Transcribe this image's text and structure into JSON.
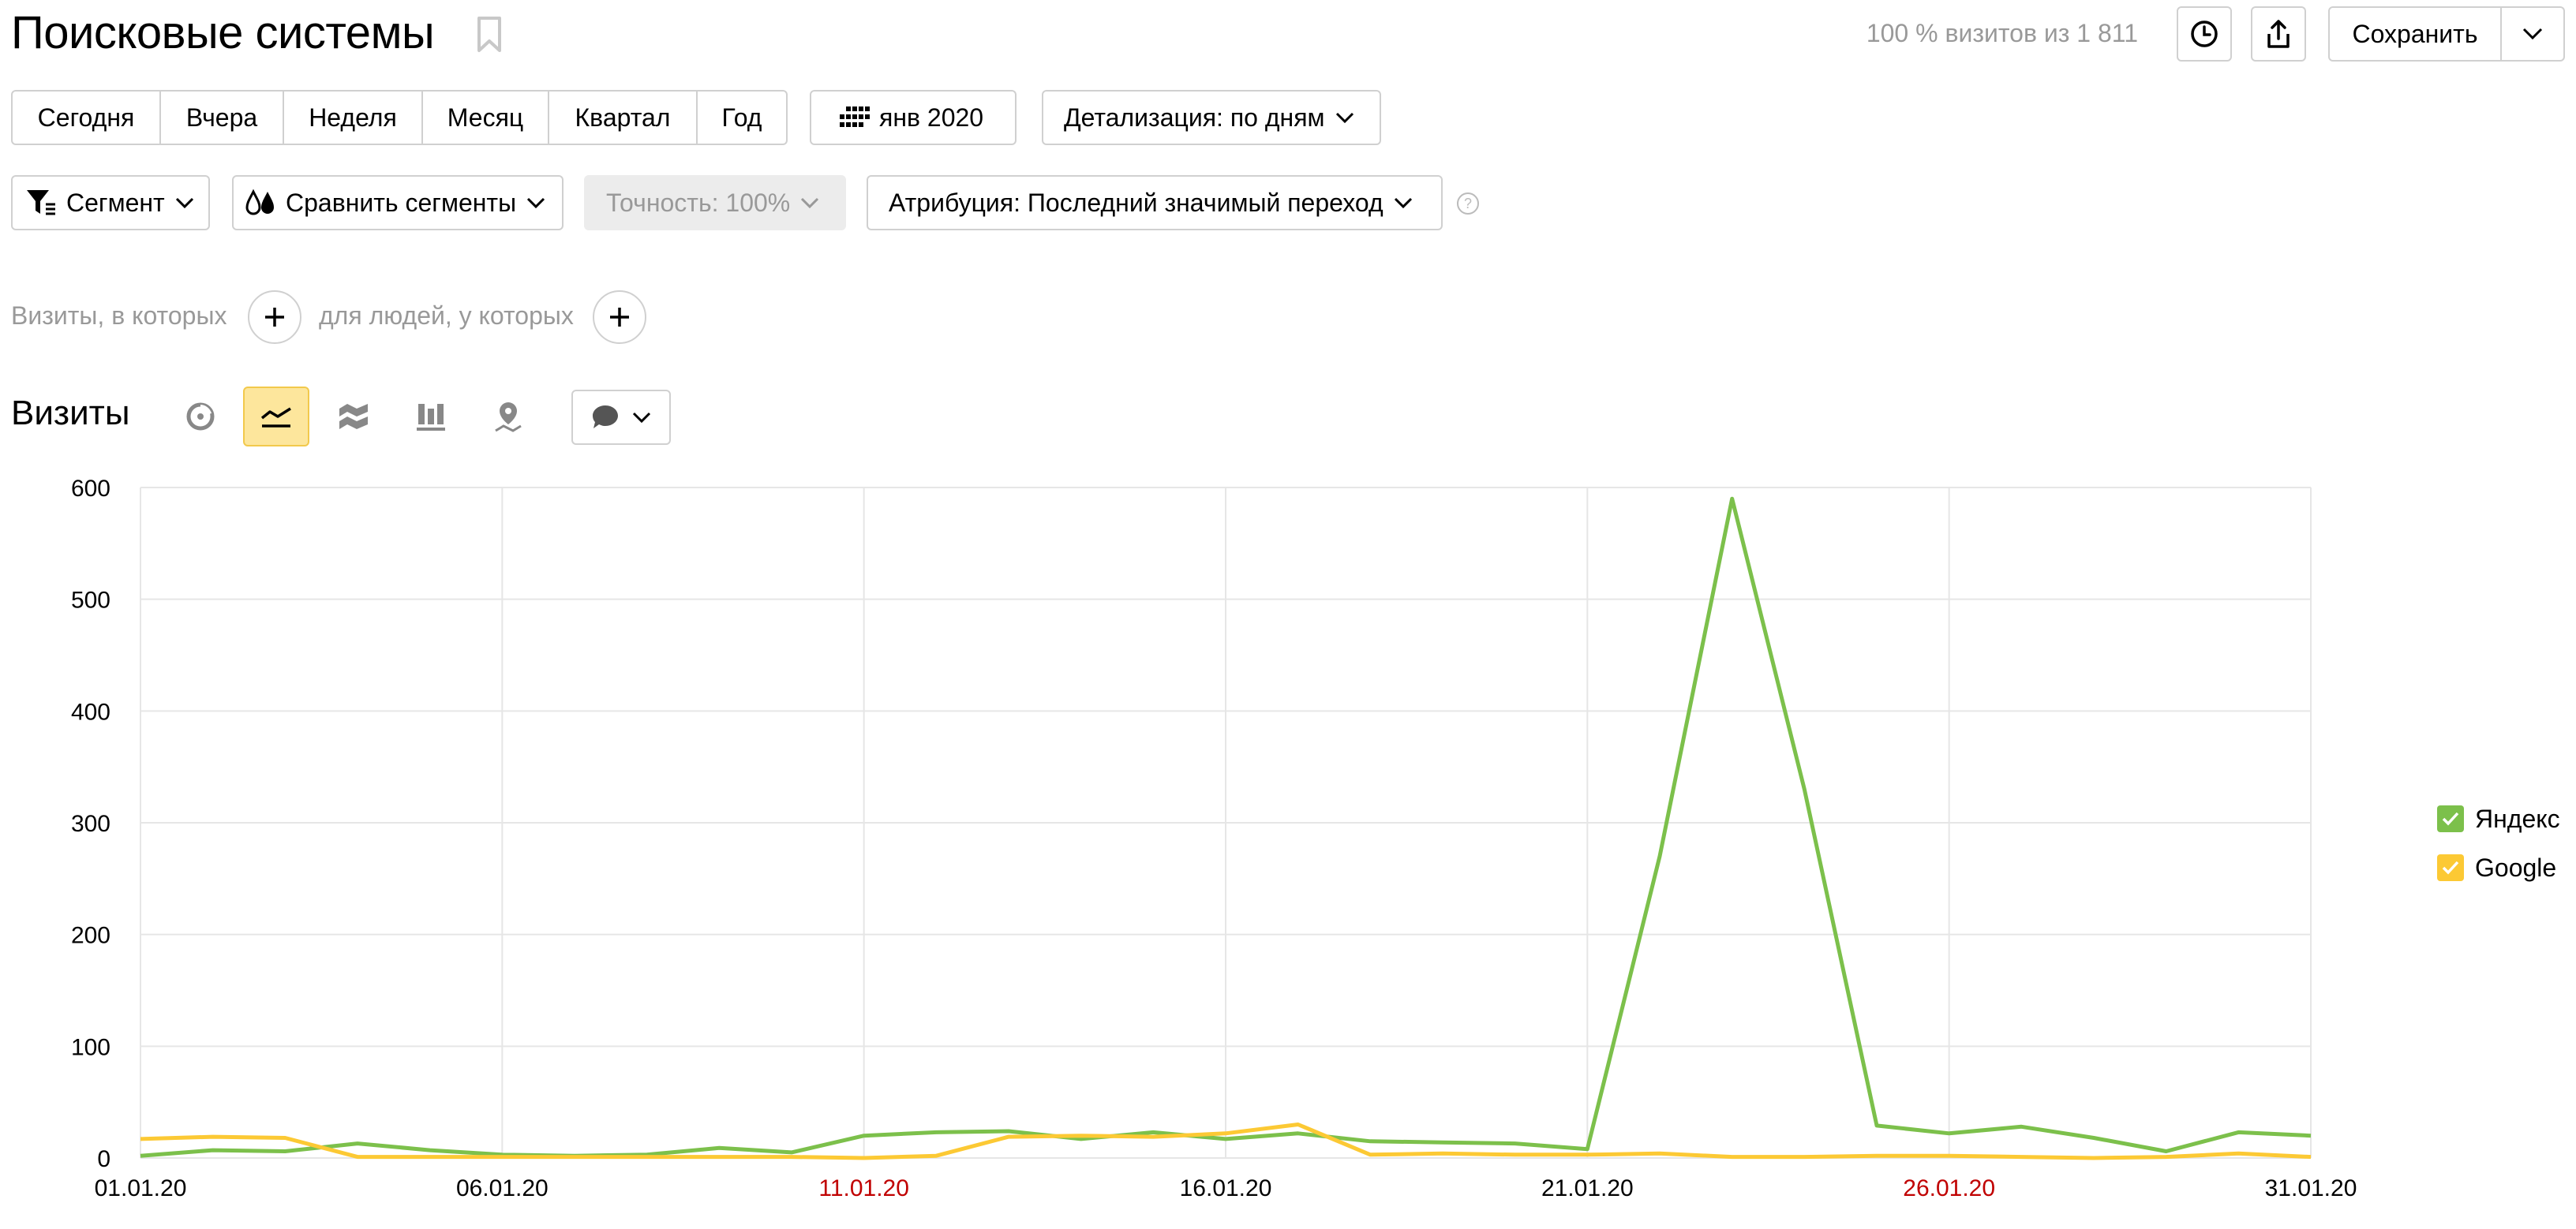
{
  "header": {
    "title": "Поисковые системы",
    "visits_info": "100 % визитов из 1 811",
    "save_label": "Сохранить"
  },
  "period": {
    "presets": [
      "Сегодня",
      "Вчера",
      "Неделя",
      "Месяц",
      "Квартал",
      "Год"
    ],
    "date_label": "янв 2020",
    "detail_label": "Детализация: по дням"
  },
  "toolbar": {
    "segment_label": "Сегмент",
    "compare_label": "Сравнить сегменты",
    "accuracy_label": "Точность: 100%",
    "attribution_label": "Атрибуция: Последний значимый переход",
    "help": "?"
  },
  "filters": {
    "visits_label": "Визиты, в которых",
    "people_label": "для людей, у которых"
  },
  "chart_section": {
    "title": "Визиты"
  },
  "colors": {
    "yandex": "#7cc04b",
    "google": "#fcc934",
    "grid": "#e6e6e6",
    "holiday": "#c00000",
    "accent_bg": "#fde69c"
  },
  "chart_data": {
    "type": "line",
    "x": [
      "01.01.20",
      "02.01.20",
      "03.01.20",
      "04.01.20",
      "05.01.20",
      "06.01.20",
      "07.01.20",
      "08.01.20",
      "09.01.20",
      "10.01.20",
      "11.01.20",
      "12.01.20",
      "13.01.20",
      "14.01.20",
      "15.01.20",
      "16.01.20",
      "17.01.20",
      "18.01.20",
      "19.01.20",
      "20.01.20",
      "21.01.20",
      "22.01.20",
      "23.01.20",
      "24.01.20",
      "25.01.20",
      "26.01.20",
      "27.01.20",
      "28.01.20",
      "29.01.20",
      "30.01.20",
      "31.01.20"
    ],
    "x_tick_labels": [
      "01.01.20",
      "06.01.20",
      "11.01.20",
      "16.01.20",
      "21.01.20",
      "26.01.20",
      "31.01.20"
    ],
    "x_tick_holiday": [
      false,
      false,
      true,
      false,
      false,
      true,
      false
    ],
    "ylim": [
      0,
      600
    ],
    "y_ticks": [
      0,
      100,
      200,
      300,
      400,
      500,
      600
    ],
    "grid": true,
    "legend": "right",
    "series": [
      {
        "name": "Яндекс",
        "values": [
          2,
          7,
          6,
          13,
          7,
          3,
          2,
          3,
          9,
          5,
          20,
          23,
          24,
          17,
          23,
          17,
          22,
          15,
          14,
          13,
          8,
          270,
          590,
          330,
          29,
          22,
          28,
          18,
          6,
          23,
          20
        ]
      },
      {
        "name": "Google",
        "values": [
          17,
          19,
          18,
          1,
          1,
          1,
          1,
          1,
          1,
          1,
          0,
          2,
          19,
          20,
          19,
          22,
          30,
          3,
          4,
          3,
          3,
          4,
          1,
          1,
          2,
          2,
          1,
          0,
          1,
          4,
          1
        ]
      }
    ]
  }
}
